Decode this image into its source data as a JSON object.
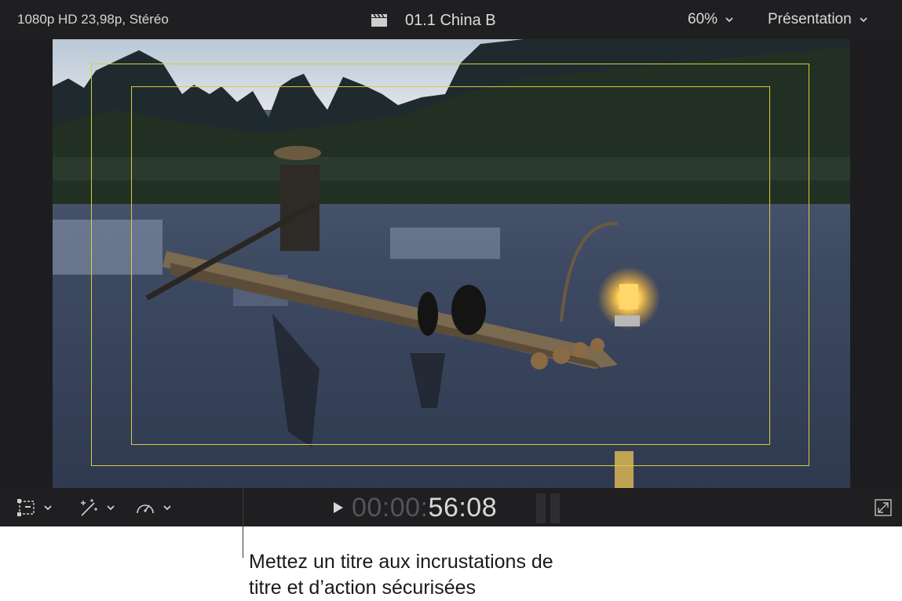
{
  "topbar": {
    "format": "1080p HD 23,98p, Stéréo",
    "clip_name": "01.1 China B",
    "zoom": "60%",
    "view_menu": "Présentation"
  },
  "playback": {
    "timecode_dim": "00:00:",
    "timecode_bright": "56:08"
  },
  "icons": {
    "clapper": "clapperboard-icon",
    "transform": "transform-icon",
    "enhance": "magic-wand-icon",
    "speed": "speedometer-icon",
    "play": "play-icon",
    "fullscreen": "fullscreen-icon"
  },
  "colors": {
    "safe_zone": "#d7cd3a",
    "viewer_bg": "#1c1c1e"
  },
  "callout": {
    "line1": "Mettez un titre aux incrustations de",
    "line2": "titre et d’action sécurisées"
  }
}
